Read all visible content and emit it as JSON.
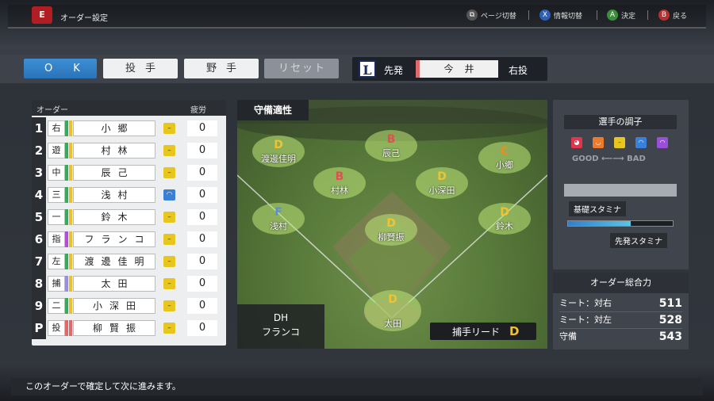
{
  "header": {
    "logo_text": "E",
    "title": "オーダー設定",
    "hints": [
      {
        "key": "⧉",
        "label": "ページ切替",
        "color": "#555"
      },
      {
        "key": "X",
        "label": "情報切替",
        "color": "#2c5fb5"
      },
      {
        "key": "A",
        "label": "決定",
        "color": "#3a8f3a"
      },
      {
        "key": "B",
        "label": "戻る",
        "color": "#b53030"
      }
    ]
  },
  "tabs": {
    "ok": "OK",
    "pitcher": "投手",
    "fielder": "野手",
    "reset": "リセット"
  },
  "starter": {
    "team_logo": "L",
    "label": "先発",
    "name": "今井",
    "hand": "右投"
  },
  "order": {
    "header_label": "オーダー",
    "fatigue_label": "疲労",
    "rows": [
      {
        "num": "1",
        "pos": "右",
        "name": "小郷",
        "fatigue": "0",
        "face": "normal"
      },
      {
        "num": "2",
        "pos": "遊",
        "name": "村林",
        "fatigue": "0",
        "face": "normal"
      },
      {
        "num": "3",
        "pos": "中",
        "name": "辰己",
        "fatigue": "0",
        "face": "normal"
      },
      {
        "num": "4",
        "pos": "三",
        "name": "浅村",
        "fatigue": "0",
        "face": "slump"
      },
      {
        "num": "5",
        "pos": "一",
        "name": "鈴木",
        "fatigue": "0",
        "face": "normal"
      },
      {
        "num": "6",
        "pos": "指",
        "name": "フランコ",
        "fatigue": "0",
        "face": "normal"
      },
      {
        "num": "7",
        "pos": "左",
        "name": "渡邊佳明",
        "fatigue": "0",
        "face": "normal"
      },
      {
        "num": "8",
        "pos": "捕",
        "name": "太田",
        "fatigue": "0",
        "face": "normal"
      },
      {
        "num": "9",
        "pos": "二",
        "name": "小深田",
        "fatigue": "0",
        "face": "normal"
      },
      {
        "num": "P",
        "pos": "投",
        "name": "柳賢振",
        "fatigue": "0",
        "face": "normal"
      }
    ]
  },
  "field": {
    "title": "守備適性",
    "dh_label": "DH",
    "dh_name": "フランコ",
    "catcher_lead_label": "捕手リード",
    "catcher_lead_grade": "D",
    "positions": [
      {
        "name": "渡邊佳明",
        "grade": "D",
        "grade_color": "#f2c230"
      },
      {
        "name": "辰己",
        "grade": "B",
        "grade_color": "#e05050"
      },
      {
        "name": "小郷",
        "grade": "C",
        "grade_color": "#f28a20"
      },
      {
        "name": "村林",
        "grade": "B",
        "grade_color": "#e05050"
      },
      {
        "name": "小深田",
        "grade": "D",
        "grade_color": "#f2c230"
      },
      {
        "name": "浅村",
        "grade": "F",
        "grade_color": "#5a8fd6"
      },
      {
        "name": "柳賢振",
        "grade": "D",
        "grade_color": "#f2c230"
      },
      {
        "name": "鈴木",
        "grade": "D",
        "grade_color": "#f2c230"
      },
      {
        "name": "太田",
        "grade": "D",
        "grade_color": "#f2c230"
      }
    ]
  },
  "condition": {
    "title": "選手の調子",
    "good": "GOOD",
    "bad": "BAD",
    "arrow": "⟵⟶",
    "base_stamina_label": "基礎スタミナ",
    "starter_stamina_label": "先発スタミナ",
    "stamina_fraction": 0.6
  },
  "total": {
    "title": "オーダー総合力",
    "rows": [
      {
        "label": "ミート：対右",
        "value": "511"
      },
      {
        "label": "ミート：対左",
        "value": "528"
      },
      {
        "label": "守備",
        "value": "543"
      }
    ]
  },
  "bottom": {
    "message": "このオーダーで確定して次に進みます。"
  }
}
